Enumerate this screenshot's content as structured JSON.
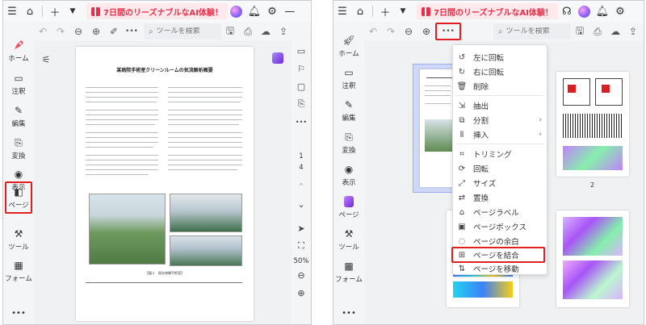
{
  "promo_text": "7日間のリーズナブルなAI体験！",
  "toolbar": {
    "search_placeholder": "ツールを検索",
    "more": "•••"
  },
  "left_sidebar": [
    {
      "label": "ホーム",
      "icon": "home-rocket-icon"
    },
    {
      "label": "注釈",
      "icon": "comment-icon"
    },
    {
      "label": "編集",
      "icon": "edit-icon"
    },
    {
      "label": "変換",
      "icon": "convert-icon"
    },
    {
      "label": "表示",
      "icon": "eye-icon"
    },
    {
      "label": "ページ",
      "icon": "page-icon"
    },
    {
      "label": "ツール",
      "icon": "tools-icon"
    },
    {
      "label": "フォーム",
      "icon": "form-icon"
    }
  ],
  "right_sidebar": [
    {
      "label": "ホーム",
      "icon": "home-rocket-icon"
    },
    {
      "label": "注釈",
      "icon": "comment-icon"
    },
    {
      "label": "編集",
      "icon": "edit-icon"
    },
    {
      "label": "変換",
      "icon": "convert-icon"
    },
    {
      "label": "表示",
      "icon": "eye-icon"
    },
    {
      "label": "ページ",
      "icon": "page-icon"
    },
    {
      "label": "ツール",
      "icon": "tools-icon"
    },
    {
      "label": "フォーム",
      "icon": "form-icon"
    }
  ],
  "doc": {
    "title": "某病院手術室クリーンルームの気流解析概要",
    "figure_caption": "【図１　既存病棟手術室】"
  },
  "page_nav": {
    "current": "1",
    "total": "4",
    "zoom": "50%"
  },
  "thumbnails": {
    "page2_label": "2"
  },
  "context_menu": [
    {
      "label": "左に回転",
      "icon": "rotate-left-icon"
    },
    {
      "label": "右に回転",
      "icon": "rotate-right-icon"
    },
    {
      "label": "削除",
      "icon": "trash-icon"
    },
    {
      "label": "抽出",
      "icon": "extract-icon"
    },
    {
      "label": "分割",
      "icon": "split-icon",
      "submenu": true
    },
    {
      "label": "挿入",
      "icon": "insert-icon",
      "submenu": true
    },
    {
      "label": "トリミング",
      "icon": "crop-icon"
    },
    {
      "label": "回転",
      "icon": "rotate-icon"
    },
    {
      "label": "サイズ",
      "icon": "size-icon"
    },
    {
      "label": "置換",
      "icon": "replace-icon"
    },
    {
      "label": "ページラベル",
      "icon": "label-icon"
    },
    {
      "label": "ページボックス",
      "icon": "pagebox-icon"
    },
    {
      "label": "ページの余白",
      "icon": "margin-icon"
    },
    {
      "label": "ページを結合",
      "icon": "merge-icon"
    },
    {
      "label": "ページを移動",
      "icon": "move-icon"
    }
  ],
  "colors": {
    "accent_red": "#e02020",
    "promo_red": "#e5324b",
    "thumb_selected": "#cfd9f7"
  }
}
